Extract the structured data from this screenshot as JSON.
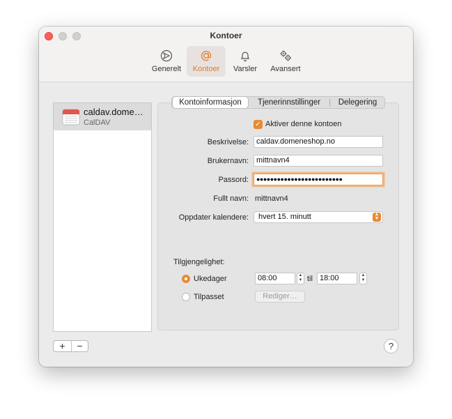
{
  "window": {
    "title": "Kontoer"
  },
  "toolbar": {
    "items": [
      {
        "label": "Generelt",
        "icon": "general-icon"
      },
      {
        "label": "Kontoer",
        "icon": "at-sign-icon"
      },
      {
        "label": "Varsler",
        "icon": "bell-icon"
      },
      {
        "label": "Avansert",
        "icon": "gears-icon"
      }
    ],
    "selected": "Kontoer"
  },
  "accounts": [
    {
      "name": "caldav.domeneshop.no",
      "display_name": "caldav.dome…",
      "type": "CalDAV"
    }
  ],
  "list_controls": {
    "add": "+",
    "remove": "−"
  },
  "help": {
    "label": "?"
  },
  "tabs": {
    "items": [
      "Kontoinformasjon",
      "Tjenerinnstillinger",
      "Delegering"
    ],
    "active": "Kontoinformasjon"
  },
  "form": {
    "enable_label": "Aktiver denne kontoen",
    "enable_checked": true,
    "description_label": "Beskrivelse:",
    "description_value": "caldav.domeneshop.no",
    "username_label": "Brukernavn:",
    "username_value": "mittnavn4",
    "password_label": "Passord:",
    "password_value": "●●●●●●●●●●●●●●●●●●●●●●●●●",
    "fullname_label": "Fullt navn:",
    "fullname_value": "mittnavn4",
    "refresh_label": "Oppdater kalendere:",
    "refresh_value": "hvert 15. minutt"
  },
  "availability": {
    "label": "Tilgjengelighet:",
    "weekdays_label": "Ukedager",
    "weekdays_selected": true,
    "from": "08:00",
    "to_label": "til",
    "to": "18:00",
    "custom_label": "Tilpasset",
    "edit_button": "Rediger…"
  },
  "colors": {
    "accent": "#e98a32",
    "close": "#ff5f57",
    "calendar_red": "#e2574c"
  }
}
